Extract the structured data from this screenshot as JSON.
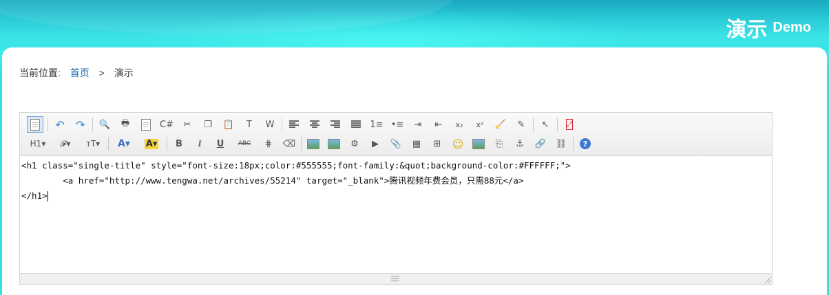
{
  "header": {
    "title_cn": "演示",
    "title_en": "Demo"
  },
  "breadcrumb": {
    "label": "当前位置:",
    "home": "首页",
    "separator": ">",
    "current": "演示"
  },
  "toolbar": {
    "row1": [
      {
        "name": "source-icon",
        "glyph": ""
      },
      {
        "name": "undo-icon",
        "glyph": "↶"
      },
      {
        "name": "redo-icon",
        "glyph": "↷"
      },
      {
        "name": "preview-icon",
        "glyph": "🔍"
      },
      {
        "name": "print-icon",
        "glyph": "🖶"
      },
      {
        "name": "template-icon",
        "glyph": ""
      },
      {
        "name": "code-icon",
        "glyph": "C#"
      },
      {
        "name": "cut-icon",
        "glyph": "✂"
      },
      {
        "name": "copy-icon",
        "glyph": "❐"
      },
      {
        "name": "paste-icon",
        "glyph": "📋"
      },
      {
        "name": "paste-text-icon",
        "glyph": "T"
      },
      {
        "name": "paste-word-icon",
        "glyph": "W"
      },
      {
        "name": "align-left-icon",
        "glyph": ""
      },
      {
        "name": "align-center-icon",
        "glyph": ""
      },
      {
        "name": "align-right-icon",
        "glyph": ""
      },
      {
        "name": "justify-icon",
        "glyph": ""
      },
      {
        "name": "ordered-list-icon",
        "glyph": "1≡"
      },
      {
        "name": "unordered-list-icon",
        "glyph": "•≡"
      },
      {
        "name": "indent-icon",
        "glyph": "⇥"
      },
      {
        "name": "outdent-icon",
        "glyph": "⇤"
      },
      {
        "name": "subscript-icon",
        "glyph": "x₂"
      },
      {
        "name": "superscript-icon",
        "glyph": "x²"
      },
      {
        "name": "clear-format-icon",
        "glyph": "🧹"
      },
      {
        "name": "select-all-icon",
        "glyph": "✎"
      },
      {
        "name": "cursor-icon",
        "glyph": "↖"
      },
      {
        "name": "fullscreen-icon",
        "glyph": "⤢"
      }
    ],
    "row2": [
      {
        "name": "heading-icon",
        "glyph": "H1▾"
      },
      {
        "name": "font-family-icon",
        "glyph": "𝓕▾"
      },
      {
        "name": "font-size-icon",
        "glyph": "тT▾"
      },
      {
        "name": "font-color-icon",
        "glyph": "A▾"
      },
      {
        "name": "highlight-icon",
        "glyph": "A▾"
      },
      {
        "name": "bold-icon",
        "glyph": "B"
      },
      {
        "name": "italic-icon",
        "glyph": "I"
      },
      {
        "name": "underline-icon",
        "glyph": "U"
      },
      {
        "name": "strikethrough-icon",
        "glyph": "ABC"
      },
      {
        "name": "horizontal-rule-icon",
        "glyph": "⋕"
      },
      {
        "name": "eraser-icon",
        "glyph": "⌫"
      },
      {
        "name": "image-icon",
        "glyph": ""
      },
      {
        "name": "multi-image-icon",
        "glyph": ""
      },
      {
        "name": "flash-icon",
        "glyph": "⚙"
      },
      {
        "name": "media-icon",
        "glyph": "▶"
      },
      {
        "name": "attachment-icon",
        "glyph": "📎"
      },
      {
        "name": "table-icon",
        "glyph": "▦"
      },
      {
        "name": "insert-code-icon",
        "glyph": "⊞"
      },
      {
        "name": "emoticon-icon",
        "glyph": "☺"
      },
      {
        "name": "map-icon",
        "glyph": ""
      },
      {
        "name": "page-break-icon",
        "glyph": "⎘"
      },
      {
        "name": "anchor-icon",
        "glyph": "⚓"
      },
      {
        "name": "link-icon",
        "glyph": "🔗"
      },
      {
        "name": "unlink-icon",
        "glyph": "⛓"
      },
      {
        "name": "help-icon",
        "glyph": "?"
      }
    ]
  },
  "editor": {
    "lines": [
      "<h1 class=\"single-title\" style=\"font-size:18px;color:#555555;font-family:&quot;background-color:#FFFFFF;\">",
      "        <a href=\"http://www.tengwa.net/archives/55214\" target=\"_blank\">腾讯视频年费会员，只需88元</a>",
      "</h1>"
    ]
  },
  "colors": {
    "banner": "#36e1e4",
    "link": "#1a64a8",
    "border": "#d4d4d4"
  }
}
